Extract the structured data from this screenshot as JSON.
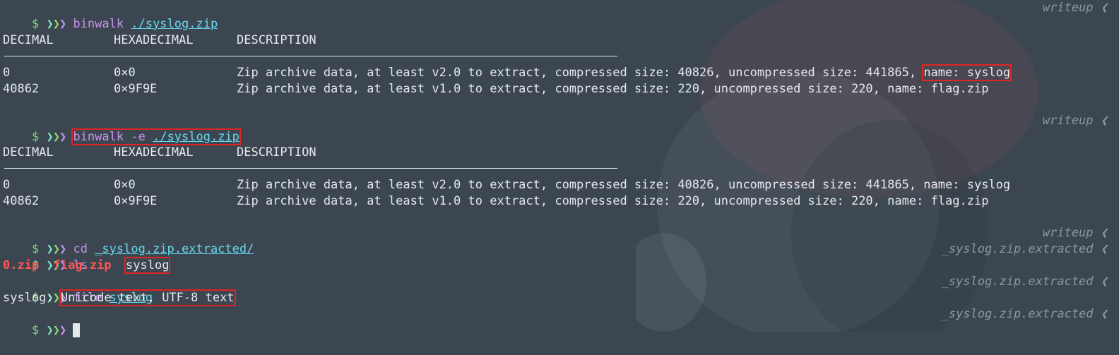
{
  "prompt": {
    "symbol": "$",
    "arrows": "❯❯❯"
  },
  "blocks": [
    {
      "cmd": "binwalk",
      "flag": "",
      "arg": "./syslog.zip",
      "rprompt": "writeup ❮",
      "headers": [
        "DECIMAL",
        "HEXADECIMAL",
        "DESCRIPTION"
      ],
      "rows": [
        {
          "dec": "0",
          "hex": "0×0",
          "desc": "Zip archive data, at least v2.0 to extract, compressed size: 40826, uncompressed size: 441865, ",
          "desc_tail": "name: syslog"
        },
        {
          "dec": "40862",
          "hex": "0×9F9E",
          "desc": "Zip archive data, at least v1.0 to extract, compressed size: 220, uncompressed size: 220, name: flag.zip",
          "desc_tail": ""
        }
      ]
    },
    {
      "cmd": "binwalk",
      "flag": "-e",
      "arg": "./syslog.zip",
      "rprompt": "writeup ❮",
      "headers": [
        "DECIMAL",
        "HEXADECIMAL",
        "DESCRIPTION"
      ],
      "rows": [
        {
          "dec": "0",
          "hex": "0×0",
          "desc": "Zip archive data, at least v2.0 to extract, compressed size: 40826, uncompressed size: 441865, name: syslog"
        },
        {
          "dec": "40862",
          "hex": "0×9F9E",
          "desc": "Zip archive data, at least v1.0 to extract, compressed size: 220, uncompressed size: 220, name: flag.zip"
        }
      ]
    }
  ],
  "cd": {
    "cmd": "cd",
    "arg": "_syslog.zip.extracted/",
    "rprompt": "writeup ❮"
  },
  "ls": {
    "cmd": "ls",
    "rprompt": "_syslog.zip.extracted ❮",
    "files": [
      "0.zip",
      "flag.zip",
      "syslog"
    ]
  },
  "file": {
    "cmd": "file",
    "arg": "syslog",
    "rprompt": "_syslog.zip.extracted ❮",
    "out_label": "syslog:",
    "out_value": "Unicode text, UTF-8 text"
  },
  "last": {
    "rprompt": "_syslog.zip.extracted ❮"
  },
  "colors": {
    "background": "#3b4650",
    "highlight": "#e02424",
    "command": "#c792ea",
    "path": "#66d9ef",
    "archive": "#ff5555"
  }
}
